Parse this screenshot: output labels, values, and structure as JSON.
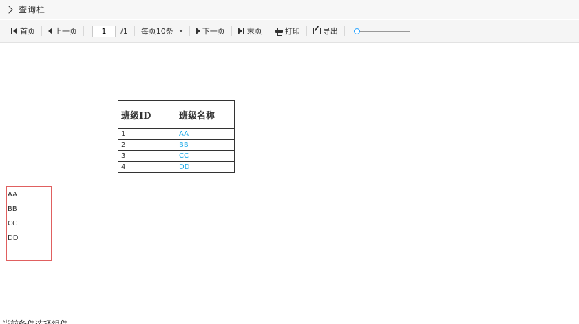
{
  "query_bar": {
    "label": "查询栏"
  },
  "toolbar": {
    "first_label": "首页",
    "prev_label": "上一页",
    "page_value": "1",
    "page_total": "/1",
    "page_size_label": "每页10条",
    "next_label": "下一页",
    "last_label": "末页",
    "print_label": "打印",
    "export_label": "导出"
  },
  "table": {
    "headers": [
      "班级ID",
      "班级名称"
    ],
    "rows": [
      {
        "id": "1",
        "name": "AA"
      },
      {
        "id": "2",
        "name": "BB"
      },
      {
        "id": "3",
        "name": "CC"
      },
      {
        "id": "4",
        "name": "DD"
      }
    ]
  },
  "list": {
    "items": [
      "AA",
      "BB",
      "CC",
      "DD"
    ]
  },
  "footer": {
    "text": "当前条件选择组件"
  },
  "colors": {
    "link": "#1aa9e8",
    "box_border": "#e06060",
    "slider_accent": "#1e9fff"
  },
  "icons": [
    "chevron-right-icon",
    "first-page-icon",
    "prev-page-icon",
    "caret-down-icon",
    "next-page-icon",
    "last-page-icon",
    "print-icon",
    "export-icon"
  ]
}
